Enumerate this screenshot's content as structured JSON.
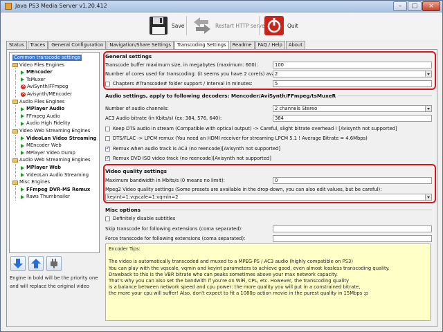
{
  "window": {
    "title": "Java PS3 Media Server v1.20.412"
  },
  "toolbar": {
    "save": "Save",
    "restart": "Restart HTTP server",
    "quit": "Quit"
  },
  "tabs": [
    "Status",
    "Traces",
    "General Configuration",
    "Navigation/Share Settings",
    "Transcoding Settings",
    "Readme",
    "FAQ / Help",
    "About"
  ],
  "tree": [
    {
      "label": "Common transcode settings",
      "level": 0,
      "icon": "none",
      "bold": false,
      "selected": true
    },
    {
      "label": "Video Files Engines",
      "level": 0,
      "icon": "folder",
      "bold": false
    },
    {
      "label": "MEncoder",
      "level": 1,
      "icon": "play",
      "bold": true
    },
    {
      "label": "TsMuxer",
      "level": 1,
      "icon": "play",
      "bold": false
    },
    {
      "label": "AviSynth/FFmpeg",
      "level": 1,
      "icon": "x",
      "bold": false
    },
    {
      "label": "Avisynth/MEncoder",
      "level": 1,
      "icon": "x",
      "bold": false
    },
    {
      "label": "Audio Files Engines",
      "level": 0,
      "icon": "folder",
      "bold": false
    },
    {
      "label": "MPlayer Audio",
      "level": 1,
      "icon": "play",
      "bold": true
    },
    {
      "label": "FFmpeg Audio",
      "level": 1,
      "icon": "play",
      "bold": false
    },
    {
      "label": "Audio High Fidelity",
      "level": 1,
      "icon": "play",
      "bold": false
    },
    {
      "label": "Video Web Streaming Engines",
      "level": 0,
      "icon": "folder",
      "bold": false
    },
    {
      "label": "VideoLan Video Streaming",
      "level": 1,
      "icon": "play",
      "bold": true
    },
    {
      "label": "MEncoder Web",
      "level": 1,
      "icon": "play",
      "bold": false
    },
    {
      "label": "MPlayer Video Dump",
      "level": 1,
      "icon": "play",
      "bold": false
    },
    {
      "label": "Audio Web Streaming Engines",
      "level": 0,
      "icon": "folder",
      "bold": false
    },
    {
      "label": "MPlayer Web",
      "level": 1,
      "icon": "play",
      "bold": true
    },
    {
      "label": "VideoLan Audio Streaming",
      "level": 1,
      "icon": "play",
      "bold": false
    },
    {
      "label": "Misc Engines",
      "level": 0,
      "icon": "folder",
      "bold": false
    },
    {
      "label": "FFmpeg DVR-MS Remux",
      "level": 1,
      "icon": "play",
      "bold": true
    },
    {
      "label": "Raws Thumbnailer",
      "level": 1,
      "icon": "play",
      "bold": false
    }
  ],
  "engine_note": "Engine in bold will be the priority one and will replace the original video",
  "general": {
    "title": "General settings",
    "buffer_label": "Transcode buffer maximum size, in megabytes (maximum: 600):",
    "buffer_value": "100",
    "cores_label": "Number of cores used for transcoding: (it seems you have 2 core(s) available)",
    "cores_value": "2",
    "chapters_label": "Chapters #Transcode# folder support / Interval in minutes:",
    "chapters_value": "5"
  },
  "audio": {
    "title": "Audio settings, apply to following decoders: Mencoder/AviSynth/FFmpeg/tsMuxeR",
    "channels_label": "Number of audio channels:",
    "channels_value": "2 channels Stereo",
    "bitrate_label": "AC3 Audio bitrate (in Kbits/s) (ex: 384, 576, 640):",
    "bitrate_value": "384",
    "dts_label": "Keep DTS audio in stream (Compatible with optical output) -> Careful, slight bitrate overhead ! [Avisynth not supported]",
    "lpcm_label": "DTS/FLAC -> LPCM remux (You need an HDMI receiver for streaming LPCM 5.1 ! Average Bitrate = 4.6Mbps)",
    "remux_ac3_label": "Remux when audio track is AC3 (no reencode)[Avisynth not supported]",
    "remux_dvd_label": "Remux DVD ISO video track (no reencode)[Avisynth not supported]"
  },
  "video": {
    "title": "Video quality settings",
    "bandwidth_label": "Maximum bandwidth in Mbits/s (0 means no limit):",
    "bandwidth_value": "0",
    "quality_label": "Mpeg2 Video quality settings (Some presets are available in the drop-down, you can also edit values, but be careful):",
    "quality_value": "keyint=1:vqscale=1:vqmin=2"
  },
  "misc": {
    "title": "Misc options",
    "subs_label": "Definitely disable subtitles",
    "skip_label": "Skip transcode for following extensions (coma separated):",
    "force_label": "Force transcode for following extensions (coma separated):"
  },
  "tips": [
    "Encoder Tips:",
    "",
    "The video is automatically transcoded and muxed to a MPEG-PS / AC3 audio (highly compatible on PS3)",
    "You can play with the vqscale, vqmin and keyint parameters to achieve good, even almost lossless transcoding quality.",
    "Drawback to this is the VBR bitrate who can peaks sometimes above your max network capacity.",
    "That's why you can also set the bandwith if you're on WiFi, CPL, etc. However, the transcoding quality",
    "is a balance between network speed and cpu power: the more quality you will put in a constrained bitrate,",
    "the more your cpu will suffer! Also, don't expect to fit a 1080p action movie in the purest quality in 15Mbps :p"
  ]
}
